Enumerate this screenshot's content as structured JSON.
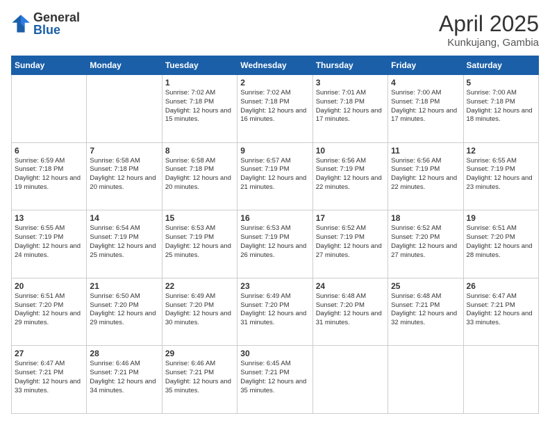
{
  "logo": {
    "general": "General",
    "blue": "Blue"
  },
  "header": {
    "month": "April 2025",
    "location": "Kunkujang, Gambia"
  },
  "weekdays": [
    "Sunday",
    "Monday",
    "Tuesday",
    "Wednesday",
    "Thursday",
    "Friday",
    "Saturday"
  ],
  "weeks": [
    [
      {
        "day": "",
        "info": ""
      },
      {
        "day": "",
        "info": ""
      },
      {
        "day": "1",
        "info": "Sunrise: 7:02 AM\nSunset: 7:18 PM\nDaylight: 12 hours and 15 minutes."
      },
      {
        "day": "2",
        "info": "Sunrise: 7:02 AM\nSunset: 7:18 PM\nDaylight: 12 hours and 16 minutes."
      },
      {
        "day": "3",
        "info": "Sunrise: 7:01 AM\nSunset: 7:18 PM\nDaylight: 12 hours and 17 minutes."
      },
      {
        "day": "4",
        "info": "Sunrise: 7:00 AM\nSunset: 7:18 PM\nDaylight: 12 hours and 17 minutes."
      },
      {
        "day": "5",
        "info": "Sunrise: 7:00 AM\nSunset: 7:18 PM\nDaylight: 12 hours and 18 minutes."
      }
    ],
    [
      {
        "day": "6",
        "info": "Sunrise: 6:59 AM\nSunset: 7:18 PM\nDaylight: 12 hours and 19 minutes."
      },
      {
        "day": "7",
        "info": "Sunrise: 6:58 AM\nSunset: 7:18 PM\nDaylight: 12 hours and 20 minutes."
      },
      {
        "day": "8",
        "info": "Sunrise: 6:58 AM\nSunset: 7:18 PM\nDaylight: 12 hours and 20 minutes."
      },
      {
        "day": "9",
        "info": "Sunrise: 6:57 AM\nSunset: 7:19 PM\nDaylight: 12 hours and 21 minutes."
      },
      {
        "day": "10",
        "info": "Sunrise: 6:56 AM\nSunset: 7:19 PM\nDaylight: 12 hours and 22 minutes."
      },
      {
        "day": "11",
        "info": "Sunrise: 6:56 AM\nSunset: 7:19 PM\nDaylight: 12 hours and 22 minutes."
      },
      {
        "day": "12",
        "info": "Sunrise: 6:55 AM\nSunset: 7:19 PM\nDaylight: 12 hours and 23 minutes."
      }
    ],
    [
      {
        "day": "13",
        "info": "Sunrise: 6:55 AM\nSunset: 7:19 PM\nDaylight: 12 hours and 24 minutes."
      },
      {
        "day": "14",
        "info": "Sunrise: 6:54 AM\nSunset: 7:19 PM\nDaylight: 12 hours and 25 minutes."
      },
      {
        "day": "15",
        "info": "Sunrise: 6:53 AM\nSunset: 7:19 PM\nDaylight: 12 hours and 25 minutes."
      },
      {
        "day": "16",
        "info": "Sunrise: 6:53 AM\nSunset: 7:19 PM\nDaylight: 12 hours and 26 minutes."
      },
      {
        "day": "17",
        "info": "Sunrise: 6:52 AM\nSunset: 7:19 PM\nDaylight: 12 hours and 27 minutes."
      },
      {
        "day": "18",
        "info": "Sunrise: 6:52 AM\nSunset: 7:20 PM\nDaylight: 12 hours and 27 minutes."
      },
      {
        "day": "19",
        "info": "Sunrise: 6:51 AM\nSunset: 7:20 PM\nDaylight: 12 hours and 28 minutes."
      }
    ],
    [
      {
        "day": "20",
        "info": "Sunrise: 6:51 AM\nSunset: 7:20 PM\nDaylight: 12 hours and 29 minutes."
      },
      {
        "day": "21",
        "info": "Sunrise: 6:50 AM\nSunset: 7:20 PM\nDaylight: 12 hours and 29 minutes."
      },
      {
        "day": "22",
        "info": "Sunrise: 6:49 AM\nSunset: 7:20 PM\nDaylight: 12 hours and 30 minutes."
      },
      {
        "day": "23",
        "info": "Sunrise: 6:49 AM\nSunset: 7:20 PM\nDaylight: 12 hours and 31 minutes."
      },
      {
        "day": "24",
        "info": "Sunrise: 6:48 AM\nSunset: 7:20 PM\nDaylight: 12 hours and 31 minutes."
      },
      {
        "day": "25",
        "info": "Sunrise: 6:48 AM\nSunset: 7:21 PM\nDaylight: 12 hours and 32 minutes."
      },
      {
        "day": "26",
        "info": "Sunrise: 6:47 AM\nSunset: 7:21 PM\nDaylight: 12 hours and 33 minutes."
      }
    ],
    [
      {
        "day": "27",
        "info": "Sunrise: 6:47 AM\nSunset: 7:21 PM\nDaylight: 12 hours and 33 minutes."
      },
      {
        "day": "28",
        "info": "Sunrise: 6:46 AM\nSunset: 7:21 PM\nDaylight: 12 hours and 34 minutes."
      },
      {
        "day": "29",
        "info": "Sunrise: 6:46 AM\nSunset: 7:21 PM\nDaylight: 12 hours and 35 minutes."
      },
      {
        "day": "30",
        "info": "Sunrise: 6:45 AM\nSunset: 7:21 PM\nDaylight: 12 hours and 35 minutes."
      },
      {
        "day": "",
        "info": ""
      },
      {
        "day": "",
        "info": ""
      },
      {
        "day": "",
        "info": ""
      }
    ]
  ]
}
